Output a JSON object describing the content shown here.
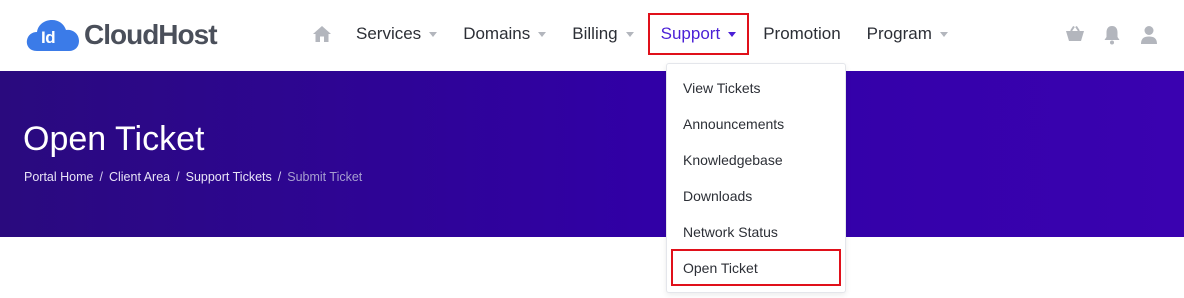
{
  "brand": {
    "logo_badge": "Id",
    "name": "CloudHost"
  },
  "nav": {
    "home_icon": "home-icon",
    "items": [
      {
        "label": "Services",
        "has_caret": true
      },
      {
        "label": "Domains",
        "has_caret": true
      },
      {
        "label": "Billing",
        "has_caret": true
      },
      {
        "label": "Support",
        "has_caret": true,
        "active": true
      },
      {
        "label": "Promotion",
        "has_caret": false
      },
      {
        "label": "Program",
        "has_caret": true
      }
    ]
  },
  "header_icons": [
    "cart-icon",
    "bell-icon",
    "user-icon"
  ],
  "hero": {
    "title": "Open Ticket",
    "breadcrumb": [
      "Portal Home",
      "Client Area",
      "Support Tickets",
      "Submit Ticket"
    ],
    "separator": "/"
  },
  "support_menu": {
    "items": [
      "View Tickets",
      "Announcements",
      "Knowledgebase",
      "Downloads",
      "Network Status",
      "Open Ticket"
    ]
  },
  "colors": {
    "accent": "#4a1fd6",
    "highlight_border": "#e0101a",
    "hero_start": "#2a0a7e",
    "hero_end": "#3a02b0",
    "logo_blue": "#3b7be8"
  }
}
